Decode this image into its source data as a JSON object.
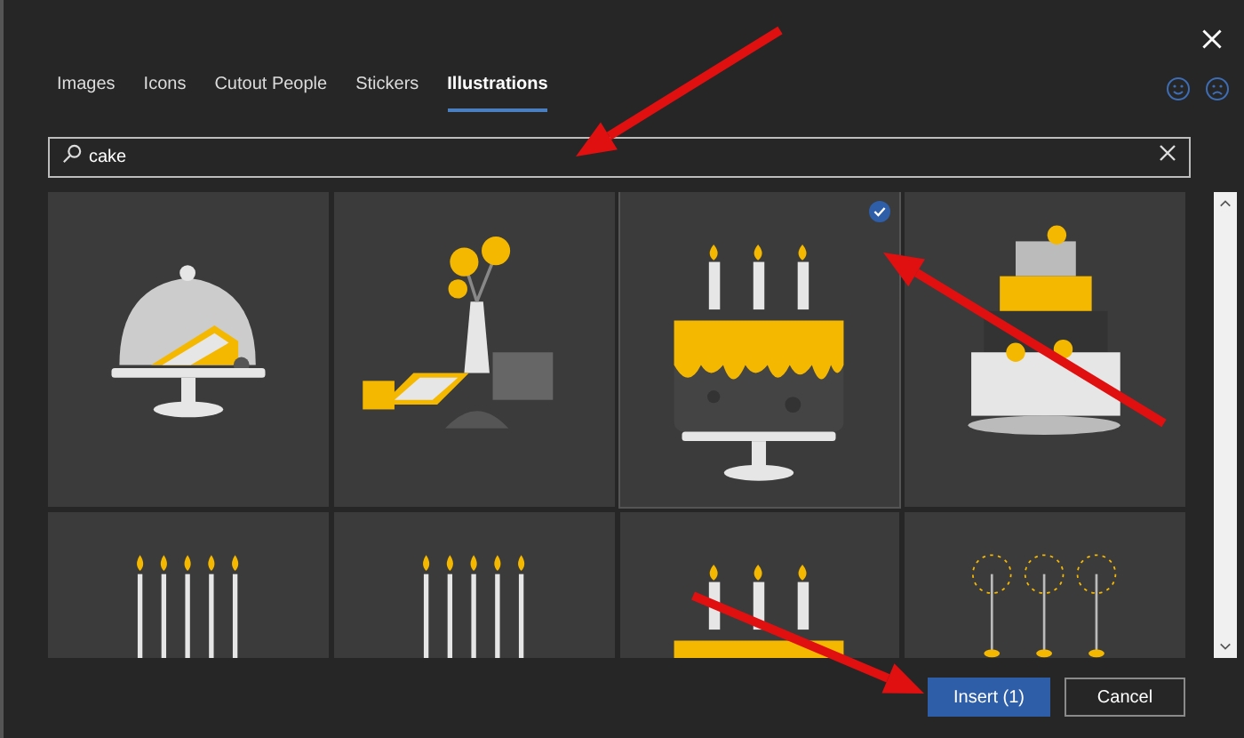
{
  "tabs": [
    {
      "label": "Images",
      "selected": false
    },
    {
      "label": "Icons",
      "selected": false
    },
    {
      "label": "Cutout People",
      "selected": false
    },
    {
      "label": "Stickers",
      "selected": false
    },
    {
      "label": "Illustrations",
      "selected": true
    }
  ],
  "search": {
    "value": "cake"
  },
  "tiles": [
    {
      "kind": "dome",
      "selected": false
    },
    {
      "kind": "vase",
      "selected": false
    },
    {
      "kind": "cake",
      "selected": true
    },
    {
      "kind": "tiered",
      "selected": false
    },
    {
      "kind": "candles",
      "selected": false
    },
    {
      "kind": "candles",
      "selected": false
    },
    {
      "kind": "cake",
      "selected": false
    },
    {
      "kind": "sparklers",
      "selected": false
    }
  ],
  "buttons": [
    {
      "label": "Insert (1)",
      "kind": "primary"
    },
    {
      "label": "Cancel",
      "kind": "secondary"
    }
  ]
}
